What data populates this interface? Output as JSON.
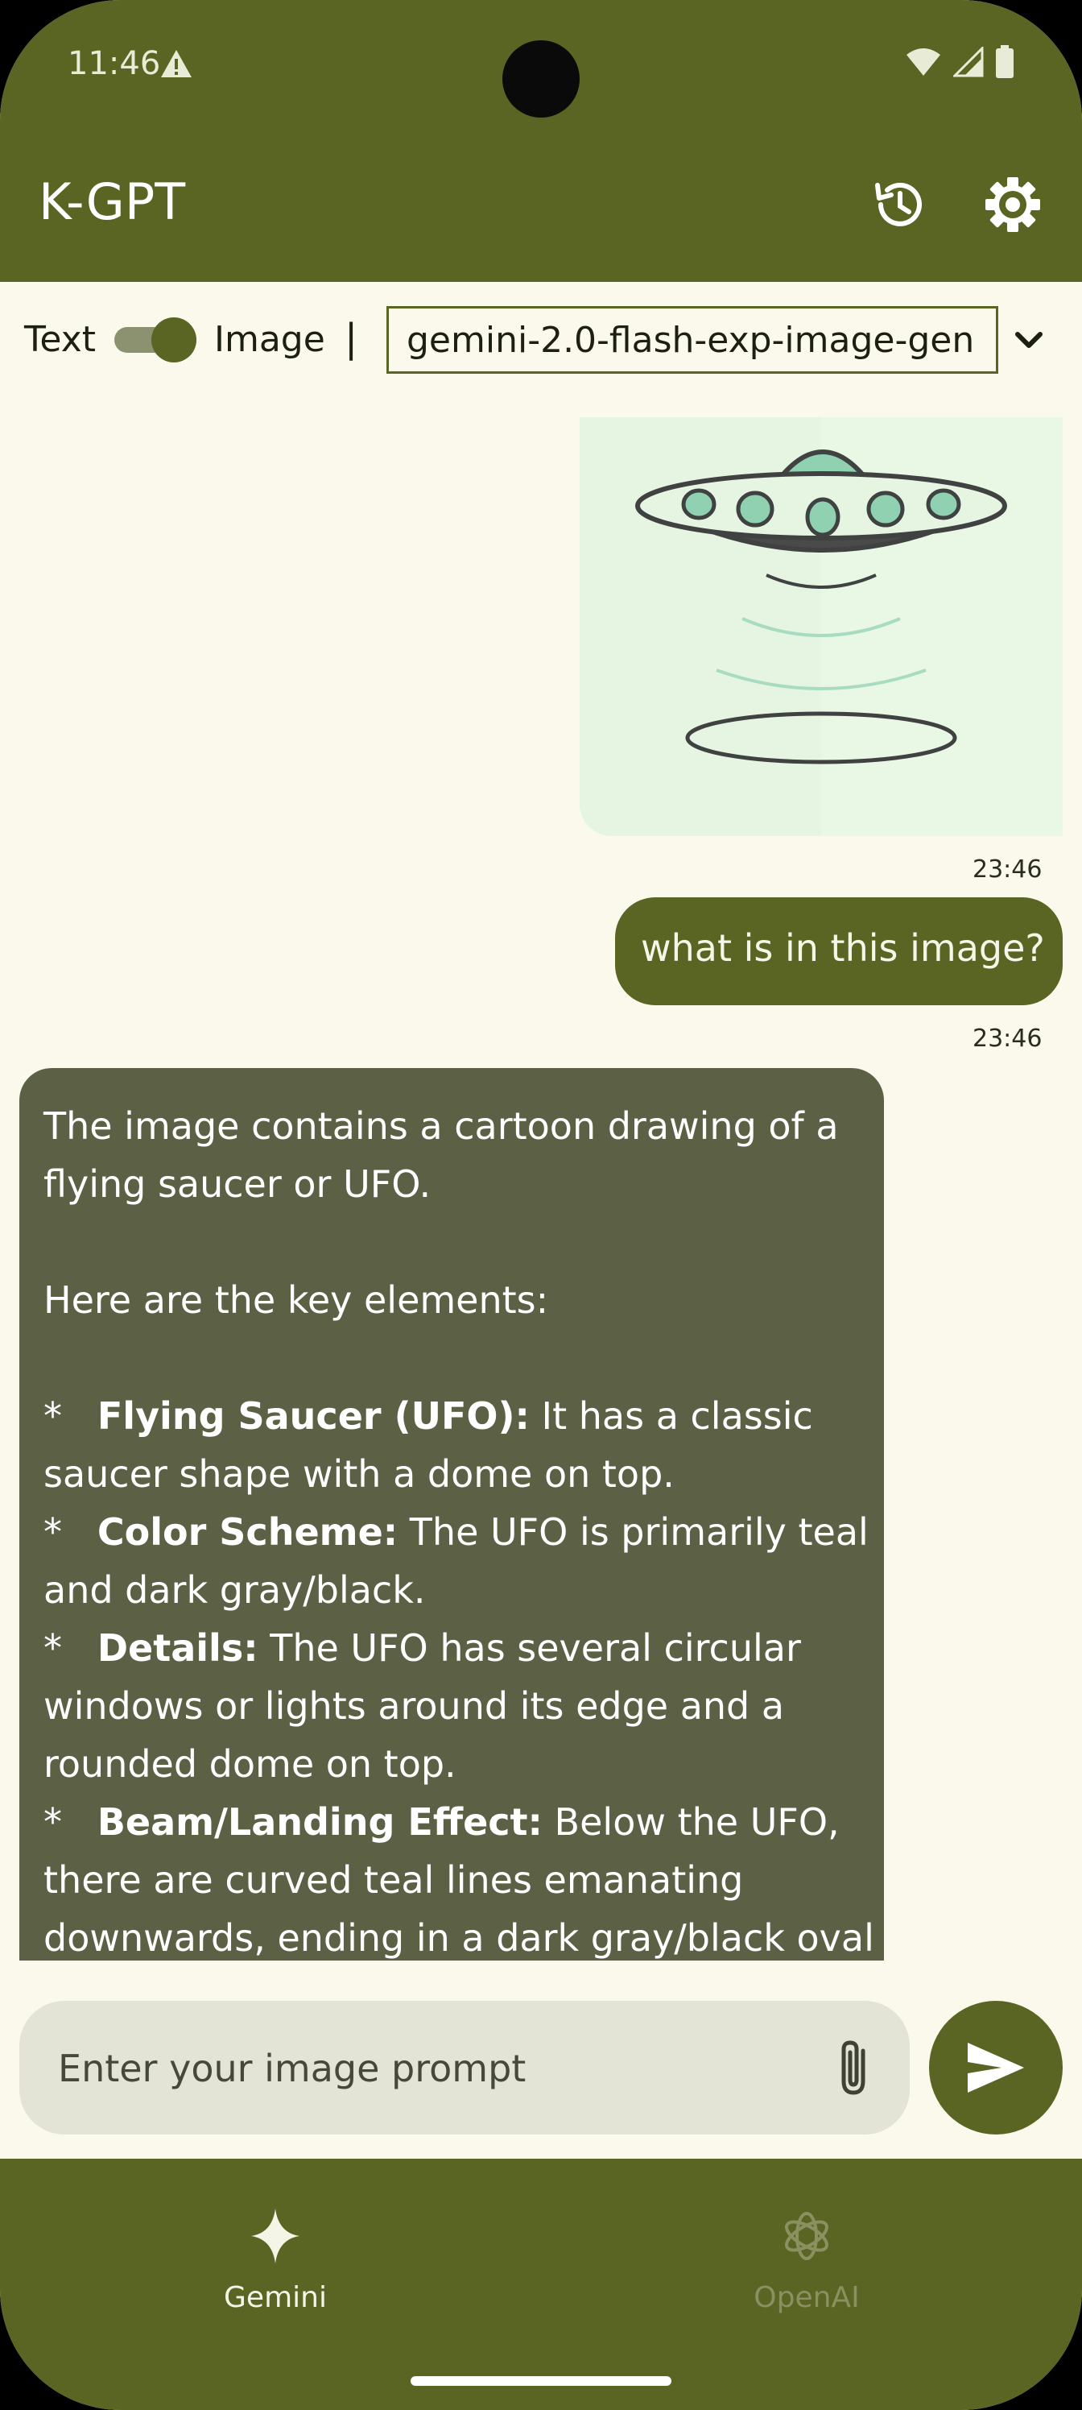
{
  "status_bar": {
    "time": "11:46"
  },
  "app_bar": {
    "title": "K-GPT"
  },
  "mode_row": {
    "text_label": "Text",
    "image_label": "Image",
    "toggle_on": true,
    "separator": "|",
    "model": "gemini-2.0-flash-exp-image-gen"
  },
  "messages": {
    "image_timestamp": "23:46",
    "user_text": "what is in this image?",
    "user_timestamp": "23:46",
    "assistant": {
      "intro": [
        "The image contains a cartoon drawing of a",
        "flying saucer or UFO."
      ],
      "heading": "Here are the key elements:",
      "bullets": [
        {
          "marker": "*",
          "title": "Flying Saucer (UFO):",
          "line1": " It has a classic",
          "rest": [
            "saucer shape with a dome on top."
          ]
        },
        {
          "marker": "*",
          "title": "Color Scheme:",
          "line1": " The UFO is primarily teal",
          "rest": [
            "and dark gray/black."
          ]
        },
        {
          "marker": "*",
          "title": "Details:",
          "line1": " The UFO has several circular",
          "rest": [
            "windows or lights around its edge and a",
            "rounded dome on top."
          ]
        },
        {
          "marker": "*",
          "title": "Beam/Landing Effect:",
          "line1": " Below the UFO,",
          "rest": [
            "there are curved teal lines emanating",
            "downwards, ending in a dark gray/black oval"
          ]
        }
      ]
    }
  },
  "input": {
    "placeholder": "Enter your image prompt"
  },
  "bottom_nav": {
    "items": [
      {
        "label": "Gemini",
        "icon": "sparkle-icon",
        "active": true
      },
      {
        "label": "OpenAI",
        "icon": "openai-icon",
        "active": false
      }
    ]
  },
  "colors": {
    "primary": "#5A6423",
    "background": "#FAF9EC",
    "assistant_bubble": "#5C6145",
    "input_background": "#E3E4D5",
    "ufo_teal": "#8FD1B0",
    "image_background": "#E5F5E2"
  }
}
